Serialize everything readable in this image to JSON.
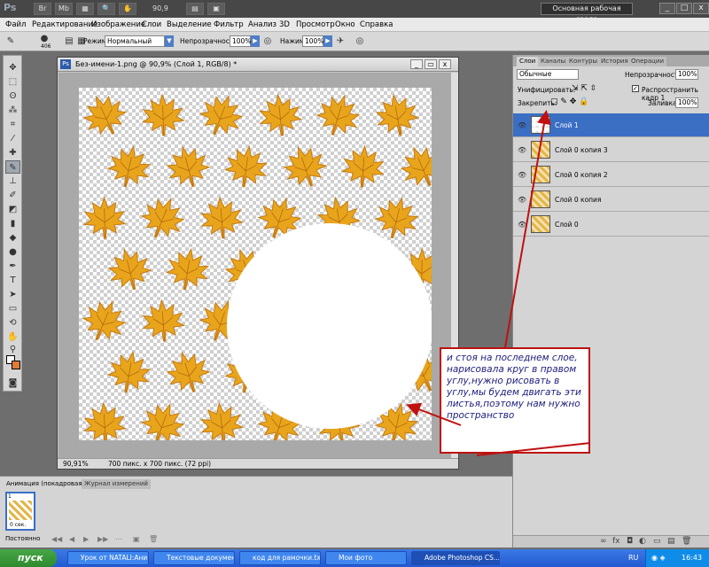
{
  "titlebar": {
    "app_icon": "Ps",
    "zoom": "90,9",
    "workspace": "Основная рабочая среда",
    "minimize": "_",
    "maximize": "□",
    "close": "x"
  },
  "menu": [
    "Файл",
    "Редактирование",
    "Изображение",
    "Слои",
    "Выделение",
    "Фильтр",
    "Анализ",
    "3D",
    "Просмотр",
    "Окно",
    "Справка"
  ],
  "options": {
    "brush_size": "406",
    "mode_label": "Режим:",
    "mode_value": "Нормальный",
    "opacity_label": "Непрозрачность:",
    "opacity_value": "100%",
    "flow_label": "Нажим:",
    "flow_value": "100%"
  },
  "document": {
    "title": "Без-имени-1.png @ 90,9% (Слой 1, RGB/8) *",
    "zoom": "90,91%",
    "info": "700 пикс. x 700 пикс. (72 ppi)"
  },
  "layers_panel": {
    "tabs": [
      "Слои",
      "Каналы",
      "Контуры",
      "История",
      "Операции"
    ],
    "blend_mode": "Обычные",
    "opacity_label": "Непрозрачность:",
    "opacity_value": "100%",
    "unify_label": "Унифицировать:",
    "propagate_label": "Распространить кадр 1",
    "lock_label": "Закрепить:",
    "fill_label": "Заливка:",
    "fill_value": "100%",
    "layers": [
      {
        "name": "Слой 1",
        "selected": true
      },
      {
        "name": "Слой 0 копия 3",
        "selected": false
      },
      {
        "name": "Слой 0 копия 2",
        "selected": false
      },
      {
        "name": "Слой 0 копия",
        "selected": false
      },
      {
        "name": "Слой 0",
        "selected": false
      }
    ]
  },
  "animation_panel": {
    "tabs": [
      "Анимация (покадровая)",
      "Журнал измерений"
    ],
    "frame_number": "1",
    "frame_delay": "0 сек.",
    "loop": "Постоянно"
  },
  "annotation": {
    "text": "и стоя на последнем слое, нарисовала круг  в правом углу,нужно рисовать в углу,мы будем двигать эти листья,поэтому нам нужно пространство",
    "color": "#c01010"
  },
  "taskbar": {
    "start": "пуск",
    "tasks": [
      "Урок от NATALI:Ани...",
      "Текстовые документы",
      "код для рамочки.txt ...",
      "Мои фото",
      "Adobe Photoshop CS..."
    ],
    "lang": "RU",
    "time": "16:43"
  },
  "colors": {
    "foreground": "#ffffff",
    "background": "#e07b39",
    "leaf": "#e8a51c",
    "selection": "#3a6fc4"
  }
}
